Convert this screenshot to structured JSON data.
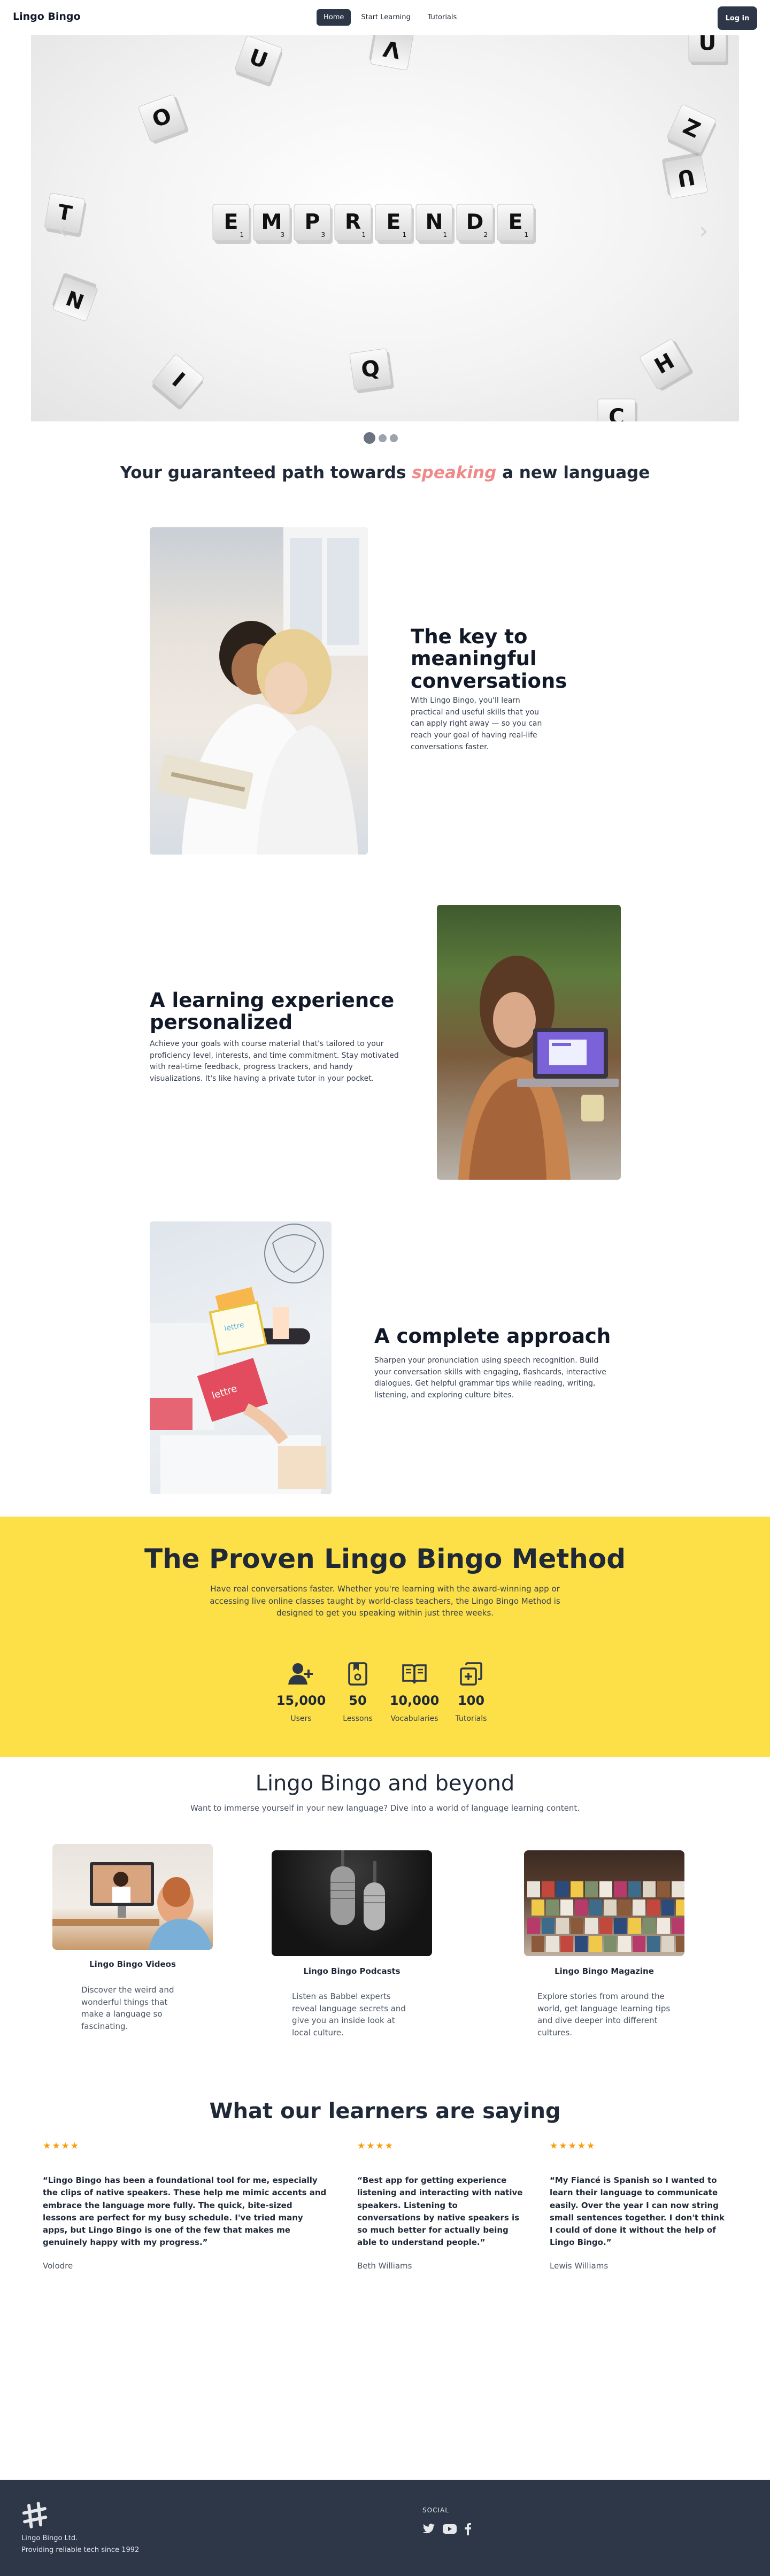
{
  "nav": {
    "brand": "Lingo Bingo",
    "links": [
      "Home",
      "Start Learning",
      "Tutorials"
    ],
    "login": "Log in"
  },
  "hero": {
    "tiles": [
      {
        "letter": "E",
        "score": "1"
      },
      {
        "letter": "M",
        "score": "3"
      },
      {
        "letter": "P",
        "score": "3"
      },
      {
        "letter": "R",
        "score": "1"
      },
      {
        "letter": "E",
        "score": "1"
      },
      {
        "letter": "N",
        "score": "1"
      },
      {
        "letter": "D",
        "score": "2"
      },
      {
        "letter": "E",
        "score": "1"
      }
    ],
    "scattered": [
      "U",
      "V",
      "O",
      "U",
      "Z",
      "U",
      "T",
      "N",
      "I",
      "Q",
      "H",
      "C"
    ]
  },
  "tagline": {
    "before": "Your guaranteed path towards ",
    "highlight": "speaking",
    "after": " a new language"
  },
  "features": [
    {
      "title": "The key to meaningful conversations",
      "text": "With Lingo Bingo, you'll learn practical and useful skills that you can apply right away — so you can reach your goal of having real-life conversations faster."
    },
    {
      "title": "A learning experience personalized",
      "text": "Achieve your goals with course material that's tailored to your proficiency level, interests, and time commitment. Stay motivated with real-time feedback, progress trackers, and handy visualizations. It's like having a private tutor in your pocket."
    },
    {
      "title": "A complete approach",
      "text": "Sharpen your pronunciation using speech recognition. Build your conversation skills with engaging, flashcards, interactive dialogues. Get helpful grammar tips while reading, writing, listening, and exploring culture bites."
    }
  ],
  "method": {
    "title": "The Proven Lingo Bingo Method",
    "text": "Have real conversations faster. Whether you're learning with the award-winning app or accessing live online classes taught by world-class teachers, the Lingo Bingo Method is designed to get you speaking within just three weeks.",
    "stats": [
      {
        "icon": "user-plus-icon",
        "value": "15,000",
        "label": "Users"
      },
      {
        "icon": "lesson-book-icon",
        "value": "50",
        "label": "Lessons"
      },
      {
        "icon": "open-book-icon",
        "value": "10,000",
        "label": "Vocabularies"
      },
      {
        "icon": "copy-plus-icon",
        "value": "100",
        "label": "Tutorials"
      }
    ]
  },
  "beyond": {
    "title": "Lingo Bingo and beyond",
    "subtitle": "Want to immerse yourself in your new language? Dive into a world of language learning content.",
    "items": [
      {
        "title": "Lingo Bingo Videos",
        "text": "Discover the weird and wonderful things that make a language so fascinating."
      },
      {
        "title": "Lingo Bingo Podcasts",
        "text": "Listen as Babbel experts reveal language secrets and give you an inside look at local culture."
      },
      {
        "title": "Lingo Bingo Magazine",
        "text": "Explore stories from around the world, get language learning tips and dive deeper into different cultures."
      }
    ]
  },
  "testimonials": {
    "title": "What our learners are saying",
    "items": [
      {
        "stars": "★★★★",
        "quote": "“Lingo Bingo has been a foundational tool for me, especially the clips of native speakers. These help me mimic accents and embrace the language more fully. The quick, bite-sized lessons are perfect for my busy schedule. I've tried many apps, but Lingo Bingo is one of the few that makes me genuinely happy with my progress.”",
        "author": "Volodre"
      },
      {
        "stars": "★★★★",
        "quote": "“Best app for getting experience listening and interacting with native speakers. Listening to conversations by native speakers is so much better for actually being able to understand people.”",
        "author": "Beth Williams"
      },
      {
        "stars": "★★★★★",
        "quote": "“My Fiancé is Spanish so I wanted to learn their language to communicate easily. Over the year I can now string small sentences together. I don't think I could of done it without the help of Lingo Bingo.”",
        "author": "Lewis Williams"
      }
    ]
  },
  "footer": {
    "name": "Lingo Bingo Ltd.",
    "tagline": "Providing reliable tech since 1992",
    "social_label": "SOCIAL",
    "social_icons": [
      "twitter-icon",
      "youtube-icon",
      "facebook-icon"
    ]
  },
  "colors": {
    "dark": "#2d3748",
    "accent_yellow": "#fde047",
    "highlight_pink": "#f08a8a",
    "star": "#f59e0b"
  }
}
